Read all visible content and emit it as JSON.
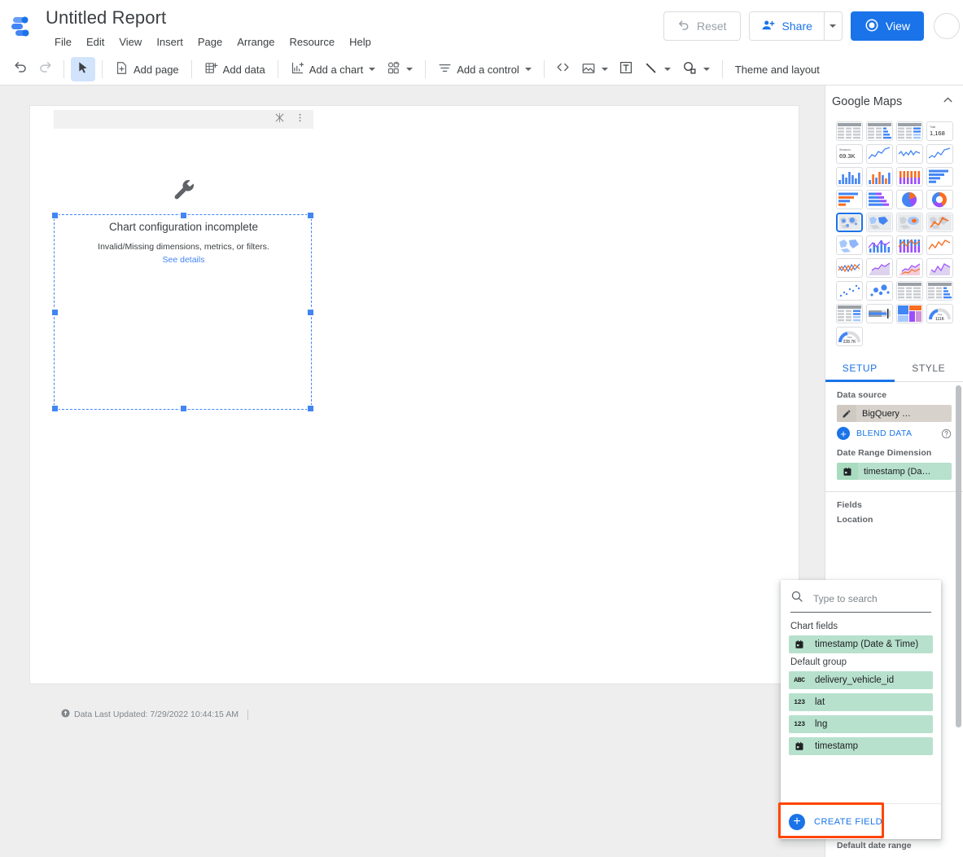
{
  "header": {
    "logo_icon": "looker-studio-logo-icon",
    "report_title": "Untitled Report",
    "menus": [
      "File",
      "Edit",
      "View",
      "Insert",
      "Page",
      "Arrange",
      "Resource",
      "Help"
    ],
    "reset_label": "Reset",
    "reset_icon": "undo-icon",
    "share_label": "Share",
    "share_icon": "person-add-icon",
    "share_caret_icon": "chevron-down-icon",
    "view_label": "View",
    "view_icon": "eye-icon",
    "avatar_icon": "avatar-circle-icon"
  },
  "toolbar": {
    "undo_icon": "undo-icon",
    "redo_icon": "redo-icon",
    "select_icon": "cursor-arrow-icon",
    "add_page_label": "Add page",
    "add_page_icon": "add-page-icon",
    "add_data_label": "Add data",
    "add_data_icon": "add-data-icon",
    "add_chart_label": "Add a chart",
    "add_chart_icon": "bar-chart-plus-icon",
    "community_viz_icon": "community-visualization-icon",
    "add_control_label": "Add a control",
    "add_control_icon": "filter-control-icon",
    "embed_icon": "embed-code-icon",
    "image_icon": "image-icon",
    "text_icon": "text-box-icon",
    "line_icon": "line-tool-icon",
    "shape_icon": "shape-tool-icon",
    "theme_layout_label": "Theme and layout"
  },
  "canvas": {
    "chart_widget": {
      "header_icons": [
        "filter-broken-icon",
        "more-vert-icon"
      ],
      "wrench_icon": "wrench-icon",
      "error_title": "Chart configuration incomplete",
      "error_subtitle": "Invalid/Missing dimensions, metrics, or filters.",
      "error_link": "See details"
    },
    "footer_note": "Data Last Updated: 7/29/2022 10:44:15 AM",
    "footer_icon": "update-clock-icon"
  },
  "right_panel": {
    "title": "Google Maps",
    "collapse_icon": "chevron-up-icon",
    "gallery": [
      {
        "name": "table-chart",
        "selected": false
      },
      {
        "name": "table-with-bars-chart",
        "selected": false
      },
      {
        "name": "table-with-heatmap-chart",
        "selected": false
      },
      {
        "name": "scorecard-chart",
        "selected": false,
        "label_top": "Total",
        "label_main": "1,168"
      },
      {
        "name": "scorecard-compact-chart",
        "selected": false,
        "label_top": "Sessions",
        "label_main": "69.3K"
      },
      {
        "name": "time-series-chart",
        "selected": false
      },
      {
        "name": "sparkline-chart",
        "selected": false
      },
      {
        "name": "smoothed-time-series-chart",
        "selected": false
      },
      {
        "name": "column-chart",
        "selected": false
      },
      {
        "name": "grouped-column-chart",
        "selected": false
      },
      {
        "name": "stacked-column-chart",
        "selected": false
      },
      {
        "name": "bar-chart",
        "selected": false
      },
      {
        "name": "grouped-bar-chart",
        "selected": false
      },
      {
        "name": "stacked-bar-chart",
        "selected": false
      },
      {
        "name": "pie-chart",
        "selected": false
      },
      {
        "name": "donut-chart",
        "selected": false
      },
      {
        "name": "google-maps-bubble-map",
        "selected": true
      },
      {
        "name": "google-maps-filled-map",
        "selected": false
      },
      {
        "name": "google-maps-heatmap",
        "selected": false
      },
      {
        "name": "google-maps-lines-map",
        "selected": false
      },
      {
        "name": "geo-chart",
        "selected": false
      },
      {
        "name": "combo-chart",
        "selected": false
      },
      {
        "name": "combo-stacked-chart",
        "selected": false
      },
      {
        "name": "line-chart",
        "selected": false
      },
      {
        "name": "multi-line-chart",
        "selected": false
      },
      {
        "name": "area-chart",
        "selected": false
      },
      {
        "name": "stacked-area-chart",
        "selected": false
      },
      {
        "name": "smoothed-area-chart",
        "selected": false
      },
      {
        "name": "scatter-chart",
        "selected": false
      },
      {
        "name": "bubble-chart",
        "selected": false
      },
      {
        "name": "pivot-table-chart",
        "selected": false
      },
      {
        "name": "pivot-table-bars-chart",
        "selected": false
      },
      {
        "name": "pivot-table-heatmap-chart",
        "selected": false
      },
      {
        "name": "bullet-chart",
        "selected": false
      },
      {
        "name": "treemap-chart",
        "selected": false
      },
      {
        "name": "gauge-chart",
        "selected": false,
        "label_top": "Total",
        "label_main": "111K"
      },
      {
        "name": "gauge-chart-alt",
        "selected": false,
        "label_top": "Total",
        "label_main": "228.7K"
      }
    ],
    "tabs": [
      {
        "label": "SETUP",
        "active": true
      },
      {
        "label": "STYLE",
        "active": false
      }
    ],
    "setup": {
      "data_source_label": "Data source",
      "data_source_value": "BigQuery …",
      "data_source_edit_icon": "pencil-icon",
      "blend_data_label": "BLEND DATA",
      "blend_plus_icon": "plus-circle-icon",
      "blend_help_icon": "help-circle-icon",
      "date_range_dimension_label": "Date Range Dimension",
      "date_range_dimension_value": "timestamp (Da…",
      "date_range_dimension_icon": "calendar-icon",
      "fields_label": "Fields",
      "location_label": "Location",
      "default_date_range_label": "Default date range"
    }
  },
  "field_dropdown": {
    "search_icon": "search-icon",
    "search_placeholder": "Type to search",
    "search_value": "",
    "groups": [
      {
        "label": "Chart fields",
        "fields": [
          {
            "name": "timestamp (Date & Time)",
            "type_icon": "calendar-icon",
            "type": "date"
          }
        ]
      },
      {
        "label": "Default group",
        "fields": [
          {
            "name": "delivery_vehicle_id",
            "type_icon": "abc-icon",
            "type": "text"
          },
          {
            "name": "lat",
            "type_icon": "123-icon",
            "type": "number"
          },
          {
            "name": "lng",
            "type_icon": "123-icon",
            "type": "number"
          },
          {
            "name": "timestamp",
            "type_icon": "calendar-icon",
            "type": "date"
          }
        ]
      }
    ],
    "create_field_label": "CREATE FIELD",
    "create_field_icon": "plus-circle-icon",
    "highlight_color": "#ff4500"
  },
  "colors": {
    "accent_blue": "#1a73e8",
    "field_green": "#b7e1cd",
    "data_source_tan": "#d7d2cb",
    "highlight_orange": "#ff4500",
    "canvas_gray": "#eeeeee"
  }
}
